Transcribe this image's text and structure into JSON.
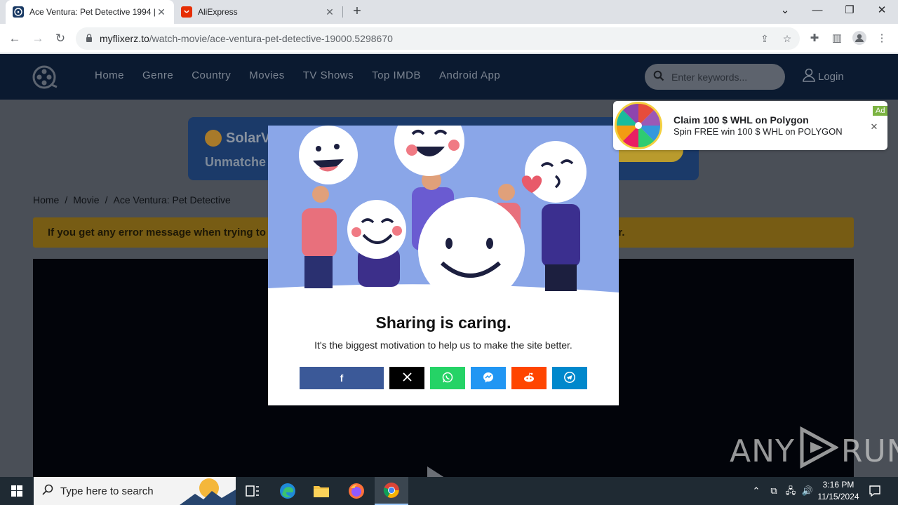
{
  "browser": {
    "tabs": [
      {
        "title": "Ace Ventura: Pet Detective 1994 |",
        "favicon": "film-reel-icon",
        "favicon_color": "#1a3a64"
      },
      {
        "title": "AliExpress",
        "favicon": "aliexpress-icon",
        "favicon_color": "#e62e04"
      }
    ],
    "url_host": "myflixerz.to",
    "url_path": "/watch-movie/ace-ventura-pet-detective-19000.5298670"
  },
  "site": {
    "nav": [
      "Home",
      "Genre",
      "Country",
      "Movies",
      "TV Shows",
      "Top IMDB",
      "Android App"
    ],
    "search_placeholder": "Enter keywords...",
    "login": "Login",
    "banner": {
      "brand": "SolarV",
      "tagline": "Unmatche"
    },
    "breadcrumbs": [
      "Home",
      "/",
      "Movie",
      "/",
      "Ace Ventura: Pet Detective"
    ],
    "notice_start": "If you get any error message when trying to",
    "notice_end": "er."
  },
  "modal": {
    "title": "Sharing is caring.",
    "subtitle": "It's the biggest motivation to help us to make the site better.",
    "share_buttons": [
      {
        "name": "facebook",
        "glyph": "f",
        "color": "#3b5998",
        "width": 120
      },
      {
        "name": "x",
        "glyph": "𝕏",
        "color": "#000000",
        "width": 50
      },
      {
        "name": "whatsapp",
        "glyph": "✆",
        "color": "#25d366",
        "width": 50
      },
      {
        "name": "messenger",
        "glyph": "✉",
        "color": "#2196f3",
        "width": 50
      },
      {
        "name": "reddit",
        "glyph": "◉",
        "color": "#ff4500",
        "width": 50
      },
      {
        "name": "telegram",
        "glyph": "➤",
        "color": "#0088cc",
        "width": 50
      }
    ]
  },
  "ad": {
    "badge": "Ad",
    "title": "Claim 100 $ WHL on Polygon",
    "text": "Spin FREE win 100 $ WHL on POLYGON"
  },
  "watermark": {
    "left": "ANY",
    "right": "RUN"
  },
  "taskbar": {
    "search_placeholder": "Type here to search",
    "time": "3:16 PM",
    "date": "11/15/2024"
  }
}
